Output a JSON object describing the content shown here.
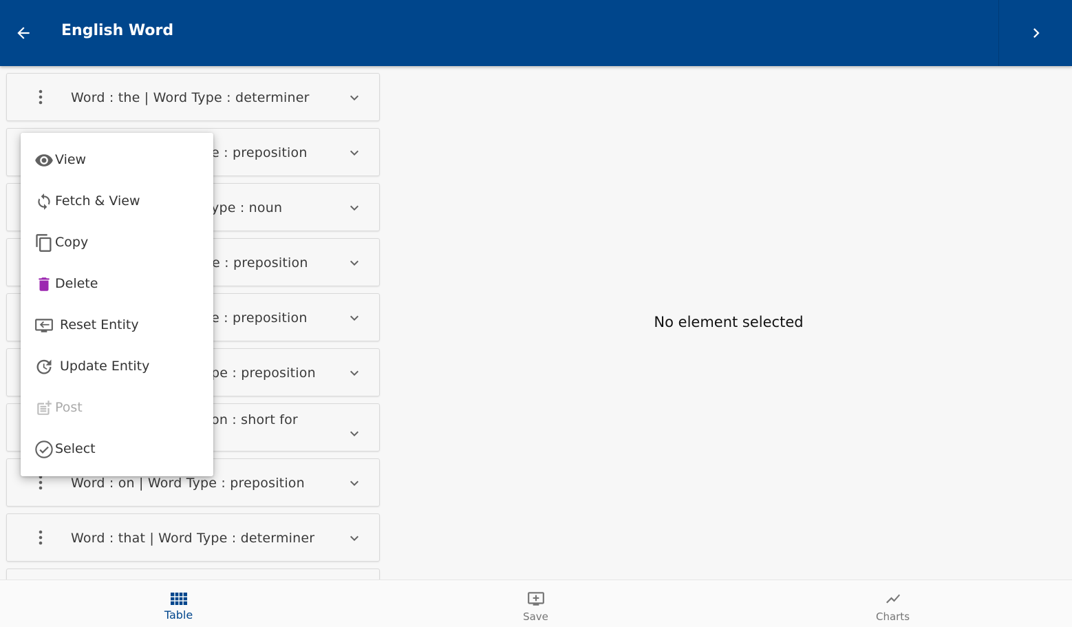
{
  "appbar": {
    "title": "English Word"
  },
  "rows": [
    {
      "text": "Word  : the | Word Type : determiner"
    },
    {
      "text": "e : preposition"
    },
    {
      "text": "ype : noun"
    },
    {
      "text": "e : preposition"
    },
    {
      "text": "e : preposition"
    },
    {
      "text": "pe : preposition"
    },
    {
      "text": "on  : short for"
    },
    {
      "text": "Word  : on | Word Type : preposition"
    },
    {
      "text": "Word  : that | Word Type : determiner"
    }
  ],
  "detail": {
    "empty_message": "No element selected"
  },
  "menu": {
    "items": [
      {
        "label": "View",
        "icon": "eye-icon"
      },
      {
        "label": "Fetch & View",
        "icon": "sync-icon"
      },
      {
        "label": "Copy",
        "icon": "copy-icon"
      },
      {
        "label": "Delete",
        "icon": "trash-icon"
      },
      {
        "label": "Reset Entity",
        "icon": "reset-icon"
      },
      {
        "label": "Update Entity",
        "icon": "update-icon"
      },
      {
        "label": "Post",
        "icon": "post-icon",
        "disabled": true
      },
      {
        "label": "Select",
        "icon": "check-circle-icon"
      }
    ]
  },
  "bottom_nav": {
    "tabs": [
      {
        "label": "Table",
        "icon": "grid-icon",
        "active": true
      },
      {
        "label": "Save",
        "icon": "add-screen-icon"
      },
      {
        "label": "Charts",
        "icon": "trend-icon"
      }
    ]
  },
  "colors": {
    "primary": "#00468c",
    "delete": "#9c27b0",
    "icon": "#616161",
    "disabled": "#bdbdbd"
  }
}
